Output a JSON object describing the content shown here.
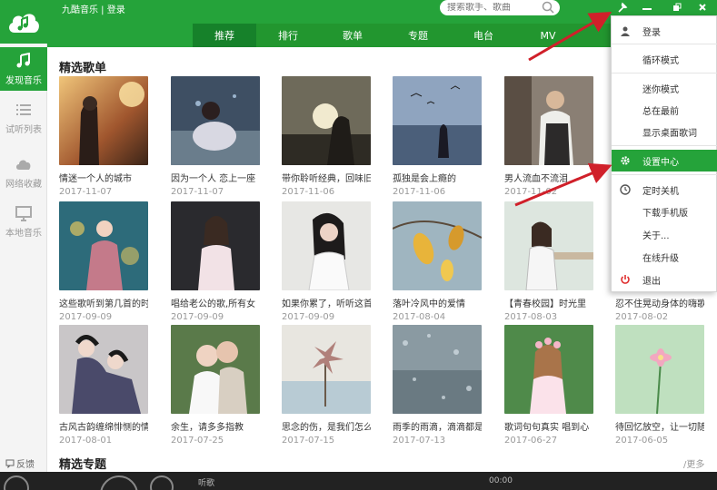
{
  "app": {
    "title": "九酷音乐 | 登录"
  },
  "search": {
    "placeholder": "搜索歌手、歌曲"
  },
  "nav_tabs": [
    "推荐",
    "排行",
    "歌单",
    "专题",
    "电台",
    "MV"
  ],
  "sidebar": {
    "items": [
      {
        "label": "发现音乐",
        "icon": "music-note-icon"
      },
      {
        "label": "试听列表",
        "icon": "list-icon"
      },
      {
        "label": "网络收藏",
        "icon": "cloud-icon"
      },
      {
        "label": "本地音乐",
        "icon": "monitor-icon"
      }
    ],
    "feedback": "反馈"
  },
  "sections": {
    "playlists": "精选歌单",
    "topics": "精选专题",
    "more": "更多"
  },
  "playlists": [
    {
      "name": "情迷一个人的城市",
      "date": "2017-11-07"
    },
    {
      "name": "因为一个人 恋上一座",
      "date": "2017-11-07"
    },
    {
      "name": "带你聆听经典，回味旧",
      "date": "2017-11-06"
    },
    {
      "name": "孤独是会上瘾的",
      "date": "2017-11-06"
    },
    {
      "name": "男人流血不流泪",
      "date": "2017-11-02"
    },
    {
      "name": "这些歌听到第几首的时",
      "date": "2017-09-09"
    },
    {
      "name": "唱给老公的歌,所有女",
      "date": "2017-09-09"
    },
    {
      "name": "如果你累了，听听这首",
      "date": "2017-09-09"
    },
    {
      "name": "落叶冷风中的爱情",
      "date": "2017-08-04"
    },
    {
      "name": "【青春校园】时光里",
      "date": "2017-08-03"
    },
    {
      "name": "忍不住晃动身体的嗨歌",
      "date": "2017-08-02"
    },
    {
      "name": "古风古韵缠绵悱恻的情",
      "date": "2017-08-01"
    },
    {
      "name": "余生，请多多指教",
      "date": "2017-07-25"
    },
    {
      "name": "思念的伤，是我们怎么",
      "date": "2017-07-15"
    },
    {
      "name": "雨季的雨滴，滴滴都是",
      "date": "2017-07-13"
    },
    {
      "name": "歌词句句真实 唱到心",
      "date": "2017-06-27"
    },
    {
      "name": "待回忆放空，让一切随",
      "date": "2017-06-05"
    }
  ],
  "menu": {
    "items": [
      "登录",
      "循环模式",
      "迷你模式",
      "总在最前",
      "显示桌面歌词",
      "设置中心",
      "定时关机",
      "下载手机版",
      "关于...",
      "在线升级",
      "退出"
    ],
    "highlighted": "设置中心"
  },
  "player": {
    "song": "听歌",
    "time": "00:00"
  },
  "colors": {
    "brand_green": "#25a33a",
    "nav_green": "#22962f",
    "annotation_red": "#d0202a"
  }
}
